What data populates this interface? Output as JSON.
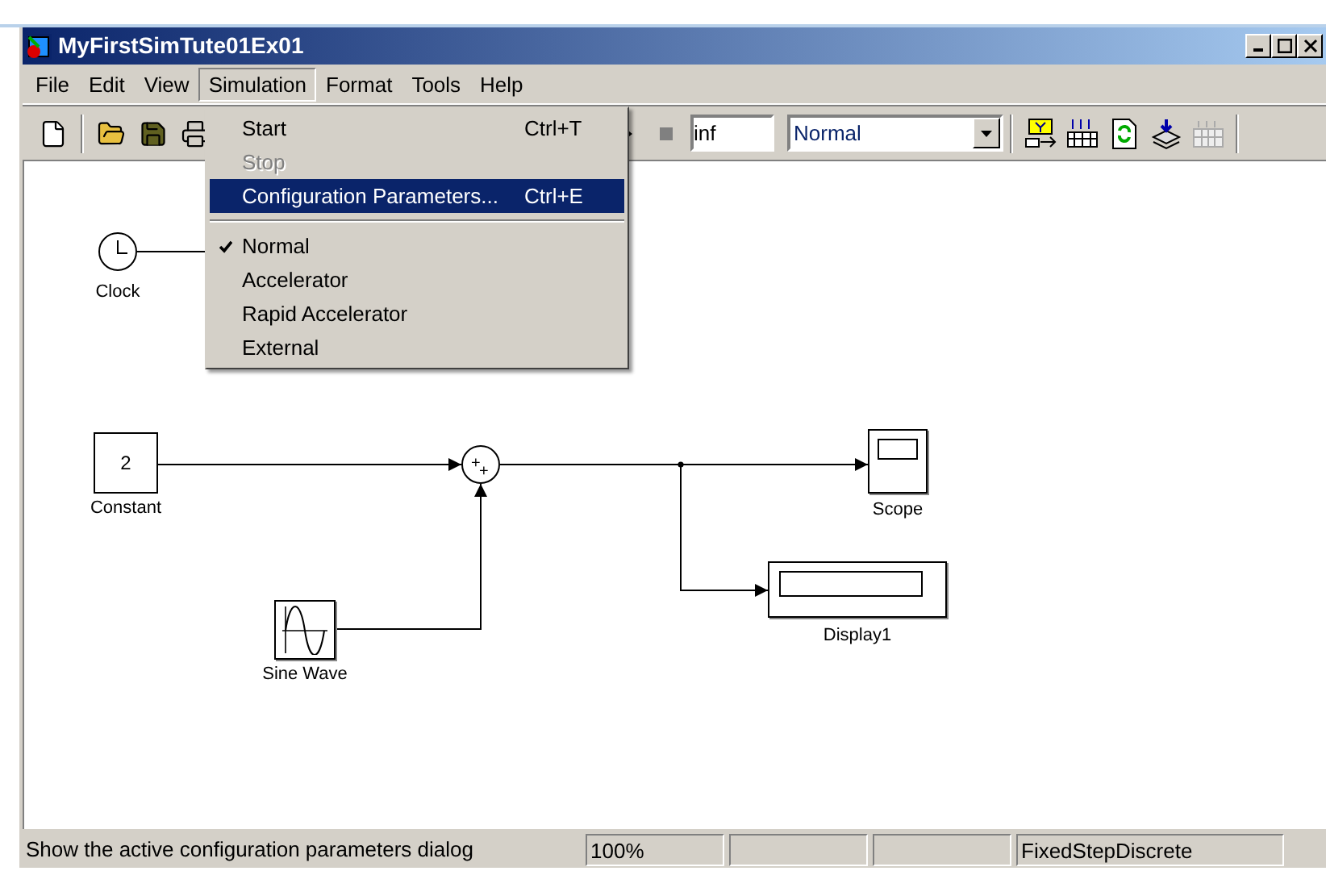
{
  "window": {
    "title": "MyFirstSimTute01Ex01"
  },
  "menu_bar": [
    {
      "label": "File",
      "selected": false
    },
    {
      "label": "Edit",
      "selected": false
    },
    {
      "label": "View",
      "selected": false
    },
    {
      "label": "Simulation",
      "selected": true
    },
    {
      "label": "Format",
      "selected": false
    },
    {
      "label": "Tools",
      "selected": false
    },
    {
      "label": "Help",
      "selected": false
    }
  ],
  "toolbar": {
    "stop_time": "inf",
    "mode": "Normal"
  },
  "simulation_menu": [
    {
      "kind": "item",
      "label": "Start",
      "shortcut": "Ctrl+T",
      "disabled": false,
      "selected": false,
      "checked": false
    },
    {
      "kind": "item",
      "label": "Stop",
      "disabled": true,
      "selected": false,
      "checked": false
    },
    {
      "kind": "item",
      "label": "Configuration Parameters...",
      "shortcut": "Ctrl+E",
      "disabled": false,
      "selected": true,
      "checked": false
    },
    {
      "kind": "separator"
    },
    {
      "kind": "item",
      "label": "Normal",
      "disabled": false,
      "selected": false,
      "checked": true
    },
    {
      "kind": "item",
      "label": "Accelerator",
      "disabled": false,
      "selected": false,
      "checked": false
    },
    {
      "kind": "item",
      "label": "Rapid Accelerator",
      "disabled": false,
      "selected": false,
      "checked": false
    },
    {
      "kind": "item",
      "label": "External",
      "disabled": false,
      "selected": false,
      "checked": false
    }
  ],
  "diagram": {
    "blocks": [
      {
        "kind": "clock",
        "label": "Clock"
      },
      {
        "kind": "constant",
        "label": "Constant",
        "value": "2"
      },
      {
        "kind": "sum",
        "signs": [
          "+",
          "+"
        ]
      },
      {
        "kind": "scope",
        "label": "Scope"
      },
      {
        "kind": "display",
        "label": "Display1"
      },
      {
        "kind": "sine",
        "label": "Sine Wave"
      }
    ]
  },
  "status_bar": {
    "message": "Show the active configuration parameters dialog",
    "zoom": "100%",
    "solver": "FixedStepDiscrete"
  }
}
